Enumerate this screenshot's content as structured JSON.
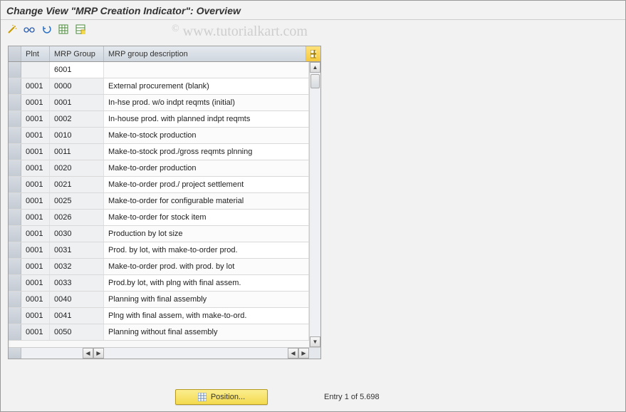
{
  "title": "Change View \"MRP Creation Indicator\": Overview",
  "watermark": "www.tutorialkart.com",
  "toolbar": {
    "icons": [
      "wand-icon",
      "glasses-icon",
      "undo-icon",
      "grid-save-icon",
      "grid-config-icon"
    ]
  },
  "table": {
    "headers": {
      "plnt": "Plnt",
      "mrpgroup": "MRP Group",
      "desc": "MRP group description"
    },
    "focus_value": "6001",
    "rows": [
      {
        "plnt": "",
        "grp": "6001",
        "desc": "",
        "focus": true
      },
      {
        "plnt": "0001",
        "grp": "0000",
        "desc": "External procurement           (blank)"
      },
      {
        "plnt": "0001",
        "grp": "0001",
        "desc": "In-hse prod. w/o indpt reqmts (initial)"
      },
      {
        "plnt": "0001",
        "grp": "0002",
        "desc": "In-house prod. with planned indpt reqmts"
      },
      {
        "plnt": "0001",
        "grp": "0010",
        "desc": "Make-to-stock production"
      },
      {
        "plnt": "0001",
        "grp": "0011",
        "desc": "Make-to-stock prod./gross reqmts plnning"
      },
      {
        "plnt": "0001",
        "grp": "0020",
        "desc": "Make-to-order production"
      },
      {
        "plnt": "0001",
        "grp": "0021",
        "desc": "Make-to-order prod./ project settlement"
      },
      {
        "plnt": "0001",
        "grp": "0025",
        "desc": "Make-to-order for configurable material"
      },
      {
        "plnt": "0001",
        "grp": "0026",
        "desc": "Make-to-order for stock item"
      },
      {
        "plnt": "0001",
        "grp": "0030",
        "desc": "Production by lot size"
      },
      {
        "plnt": "0001",
        "grp": "0031",
        "desc": "Prod. by lot, with make-to-order prod."
      },
      {
        "plnt": "0001",
        "grp": "0032",
        "desc": "Make-to-order prod. with prod. by lot"
      },
      {
        "plnt": "0001",
        "grp": "0033",
        "desc": "Prod.by lot, with plng with final assem."
      },
      {
        "plnt": "0001",
        "grp": "0040",
        "desc": "Planning with final assembly"
      },
      {
        "plnt": "0001",
        "grp": "0041",
        "desc": "Plng with final assem, with make-to-ord."
      },
      {
        "plnt": "0001",
        "grp": "0050",
        "desc": "Planning without final assembly"
      }
    ]
  },
  "position_button": "Position...",
  "status": "Entry 1 of 5.698"
}
